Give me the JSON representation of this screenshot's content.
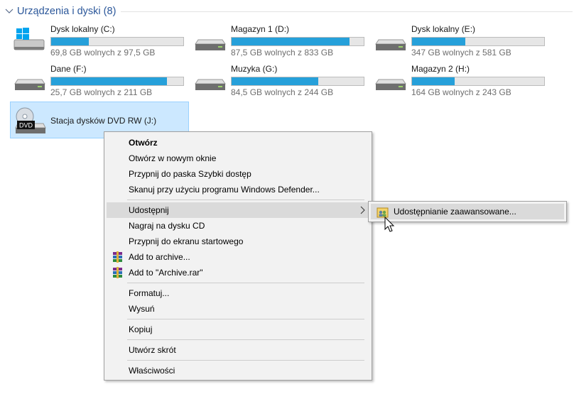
{
  "group": {
    "title": "Urządzenia i dyski (8)"
  },
  "drives": [
    {
      "name": "Dysk lokalny (C:)",
      "free": "69,8 GB wolnych z 97,5 GB",
      "used_fraction": 0.284,
      "icon": "windows-drive-icon"
    },
    {
      "name": "Magazyn 1 (D:)",
      "free": "87,5 GB wolnych z 833 GB",
      "used_fraction": 0.895,
      "icon": "hard-drive-icon"
    },
    {
      "name": "Dysk lokalny (E:)",
      "free": "347 GB wolnych z 581 GB",
      "used_fraction": 0.403,
      "icon": "hard-drive-icon"
    },
    {
      "name": "Dane (F:)",
      "free": "25,7 GB wolnych z 211 GB",
      "used_fraction": 0.878,
      "icon": "hard-drive-icon"
    },
    {
      "name": "Muzyka (G:)",
      "free": "84,5 GB wolnych z 244 GB",
      "used_fraction": 0.654,
      "icon": "hard-drive-icon"
    },
    {
      "name": "Magazyn 2 (H:)",
      "free": "164 GB wolnych z 243 GB",
      "used_fraction": 0.325,
      "icon": "hard-drive-icon"
    },
    {
      "name": "Stacja dysków DVD RW (J:)",
      "icon": "dvd-drive-icon",
      "dvd_label": "DVD"
    }
  ],
  "context_menu": {
    "items": [
      {
        "label": "Otwórz"
      },
      {
        "label": "Otwórz w nowym oknie"
      },
      {
        "label": "Przypnij do paska Szybki dostęp"
      },
      {
        "label": "Skanuj przy użyciu programu Windows Defender..."
      },
      {
        "label": "Udostępnij"
      },
      {
        "label": "Nagraj na dysku CD"
      },
      {
        "label": "Przypnij do ekranu startowego"
      },
      {
        "label": "Add to archive..."
      },
      {
        "label": "Add to \"Archive.rar\""
      },
      {
        "label": "Formatuj..."
      },
      {
        "label": "Wysuń"
      },
      {
        "label": "Kopiuj"
      },
      {
        "label": "Utwórz skrót"
      },
      {
        "label": "Właściwości"
      }
    ]
  },
  "submenu": {
    "item": "Udostępnianie zaawansowane..."
  },
  "colors": {
    "accent": "#26a0da",
    "selection": "#cce8ff",
    "menu_bg": "#f2f2f2",
    "header": "#2b579a"
  }
}
